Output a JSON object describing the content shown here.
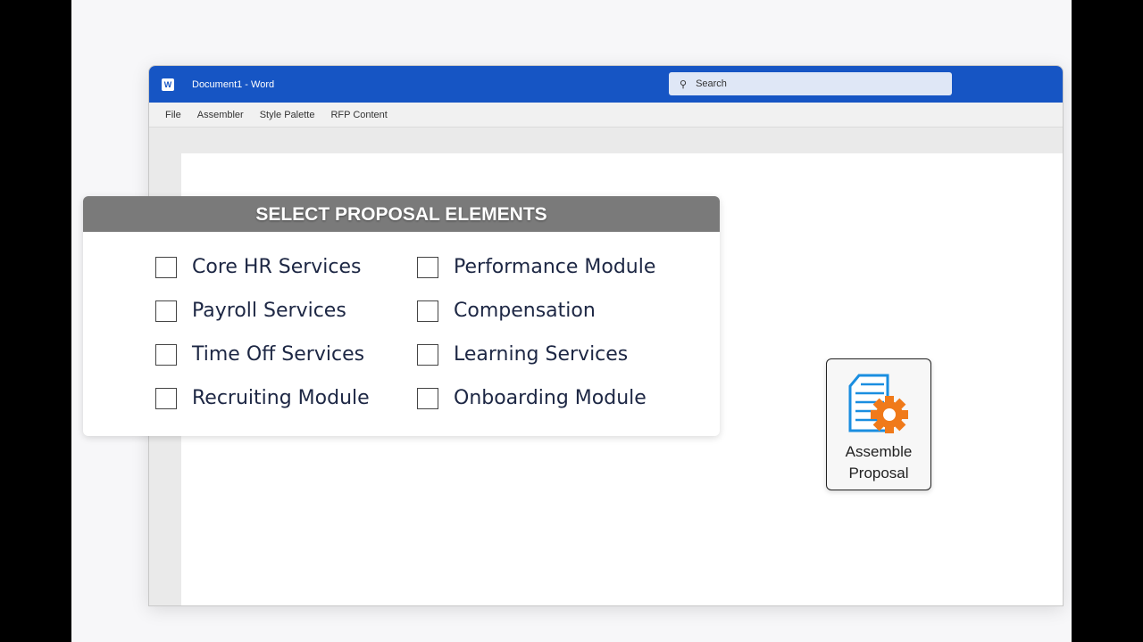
{
  "window": {
    "title": "Document1  -  Word",
    "search_placeholder": "Search"
  },
  "menu": [
    "File",
    "Assembler",
    "Style Palette",
    "RFP Content"
  ],
  "panel": {
    "title": "SELECT PROPOSAL ELEMENTS",
    "items": [
      {
        "label": "Core HR Services",
        "checked": false
      },
      {
        "label": "Payroll Services",
        "checked": false
      },
      {
        "label": "Time Off Services",
        "checked": false
      },
      {
        "label": "Recruiting Module",
        "checked": false
      },
      {
        "label": "Performance Module",
        "checked": false
      },
      {
        "label": "Compensation",
        "checked": false
      },
      {
        "label": "Learning Services",
        "checked": false
      },
      {
        "label": "Onboarding Module",
        "checked": false
      }
    ]
  },
  "assemble": {
    "line1": "Assemble",
    "line2": "Proposal"
  }
}
